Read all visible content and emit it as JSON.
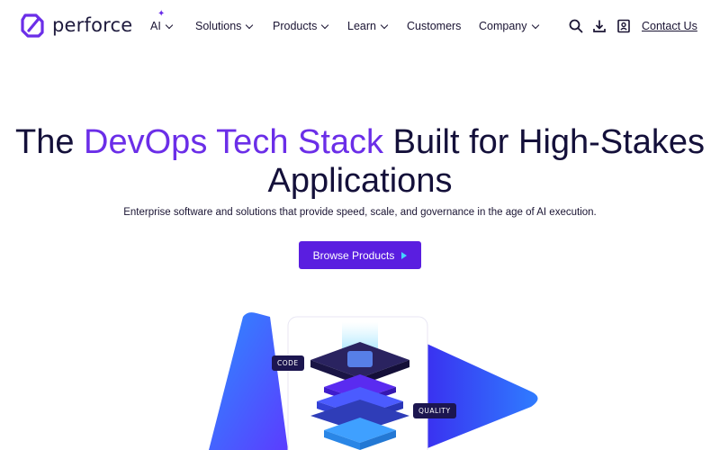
{
  "brand": {
    "name": "perforce"
  },
  "nav": {
    "items": [
      {
        "label": "AI"
      },
      {
        "label": "Solutions"
      },
      {
        "label": "Products"
      },
      {
        "label": "Learn"
      },
      {
        "label": "Customers"
      },
      {
        "label": "Company"
      }
    ],
    "contact_label": "Contact Us",
    "icons": [
      "search-icon",
      "download-icon",
      "account-icon"
    ]
  },
  "hero": {
    "title_pre": "The ",
    "title_accent": "DevOps Tech Stack",
    "title_post": " Built for High-Stakes Applications",
    "subtitle": "Enterprise software and solutions that provide speed, scale, and governance in the age of AI execution.",
    "cta_label": "Browse Products"
  },
  "illustration": {
    "tag_code": "CODE",
    "tag_quality": "QUALITY"
  },
  "colors": {
    "accent": "#6b2ee8",
    "cta": "#5a1ee0",
    "text": "#14103a",
    "cyan": "#44d4ff"
  }
}
